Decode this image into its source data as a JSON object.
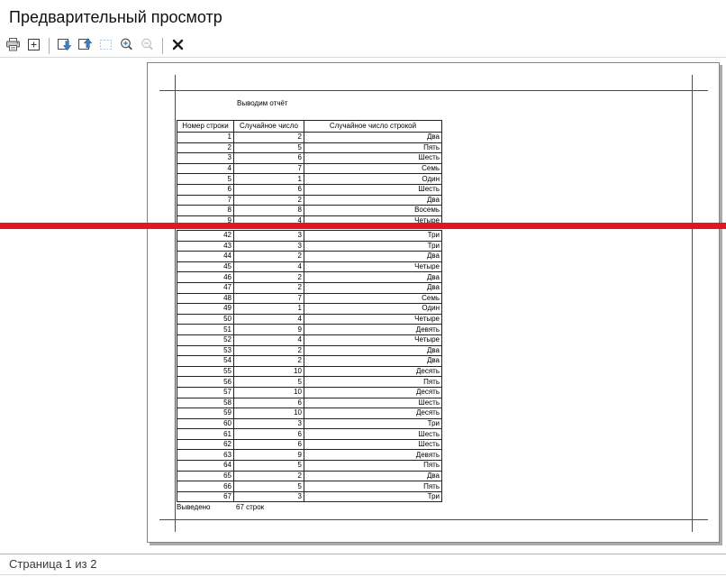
{
  "window_title": "Предварительный просмотр",
  "toolbar": {
    "icons": [
      "print-icon",
      "page-setup-icon",
      "next-page-icon",
      "prev-page-icon",
      "selection-icon",
      "zoom-in-icon",
      "zoom-out-icon",
      "close-icon"
    ]
  },
  "colors": {
    "cut_line": "#e2161c",
    "toolbar_accent_blue": "#3e7fc1"
  },
  "page": {
    "report_title": "Выводим отчёт",
    "table": {
      "headers": [
        "Номер строки",
        "Случайное число",
        "Случайное число строкой"
      ],
      "rows_top": [
        [
          "1",
          "2",
          "Два"
        ],
        [
          "2",
          "5",
          "Пять"
        ],
        [
          "3",
          "6",
          "Шесть"
        ],
        [
          "4",
          "7",
          "Семь"
        ],
        [
          "5",
          "1",
          "Один"
        ],
        [
          "6",
          "6",
          "Шесть"
        ],
        [
          "7",
          "2",
          "Два"
        ],
        [
          "8",
          "8",
          "Восемь"
        ],
        [
          "9",
          "4",
          "Четыре"
        ]
      ],
      "rows_bottom": [
        [
          "42",
          "3",
          "Три"
        ],
        [
          "43",
          "3",
          "Три"
        ],
        [
          "44",
          "2",
          "Два"
        ],
        [
          "45",
          "4",
          "Четыре"
        ],
        [
          "46",
          "2",
          "Два"
        ],
        [
          "47",
          "2",
          "Два"
        ],
        [
          "48",
          "7",
          "Семь"
        ],
        [
          "49",
          "1",
          "Один"
        ],
        [
          "50",
          "4",
          "Четыре"
        ],
        [
          "51",
          "9",
          "Девять"
        ],
        [
          "52",
          "4",
          "Четыре"
        ],
        [
          "53",
          "2",
          "Два"
        ],
        [
          "54",
          "2",
          "Два"
        ],
        [
          "55",
          "10",
          "Десять"
        ],
        [
          "56",
          "5",
          "Пять"
        ],
        [
          "57",
          "10",
          "Десять"
        ],
        [
          "58",
          "6",
          "Шесть"
        ],
        [
          "59",
          "10",
          "Десять"
        ],
        [
          "60",
          "3",
          "Три"
        ],
        [
          "61",
          "6",
          "Шесть"
        ],
        [
          "62",
          "6",
          "Шесть"
        ],
        [
          "63",
          "9",
          "Девять"
        ],
        [
          "64",
          "5",
          "Пять"
        ],
        [
          "65",
          "2",
          "Два"
        ],
        [
          "66",
          "5",
          "Пять"
        ],
        [
          "67",
          "3",
          "Три"
        ]
      ],
      "footer_label": "Выведено",
      "footer_value": "67 строк"
    }
  },
  "statusbar": {
    "text": "Страница 1 из 2"
  }
}
